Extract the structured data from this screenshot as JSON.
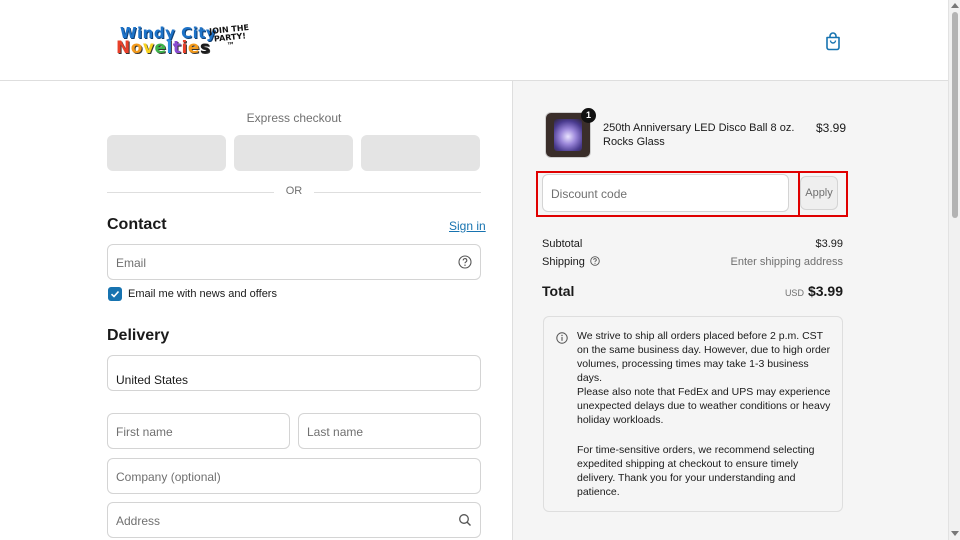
{
  "header": {
    "logo": {
      "line1": "Windy City",
      "line2": "Novelties",
      "tagline": "JOIN THE PARTY!™"
    }
  },
  "express": {
    "label": "Express checkout",
    "divider": "OR"
  },
  "contact": {
    "title": "Contact",
    "signin": "Sign in",
    "email_placeholder": "Email",
    "newsletter_label": "Email me with news and offers"
  },
  "delivery": {
    "title": "Delivery",
    "country_value": "United States",
    "first_name_placeholder": "First name",
    "last_name_placeholder": "Last name",
    "company_placeholder": "Company (optional)",
    "address_placeholder": "Address"
  },
  "cart": {
    "item": {
      "quantity": "1",
      "name": "250th Anniversary LED Disco Ball 8 oz. Rocks Glass",
      "price": "$3.99"
    },
    "discount_placeholder": "Discount code",
    "apply_label": "Apply",
    "subtotal_label": "Subtotal",
    "subtotal_value": "$3.99",
    "shipping_label": "Shipping",
    "shipping_value": "Enter shipping address",
    "total_label": "Total",
    "total_currency": "USD",
    "total_value": "$3.99"
  },
  "notice": {
    "para1": "We strive to ship all orders placed before 2 p.m. CST on the same business day. However, due to high order volumes, processing times may take 1-3 business days.",
    "para2": "Please also note that FedEx and UPS may experience unexpected delays due to weather conditions or heavy holiday workloads.",
    "para3": "For time-sensitive orders, we recommend selecting expedited shipping at checkout to ensure timely delivery. Thank you for your understanding and patience."
  },
  "colors": {
    "accent": "#1773b0",
    "highlight": "#e00000",
    "sidebar_bg": "#f5f5f5"
  }
}
